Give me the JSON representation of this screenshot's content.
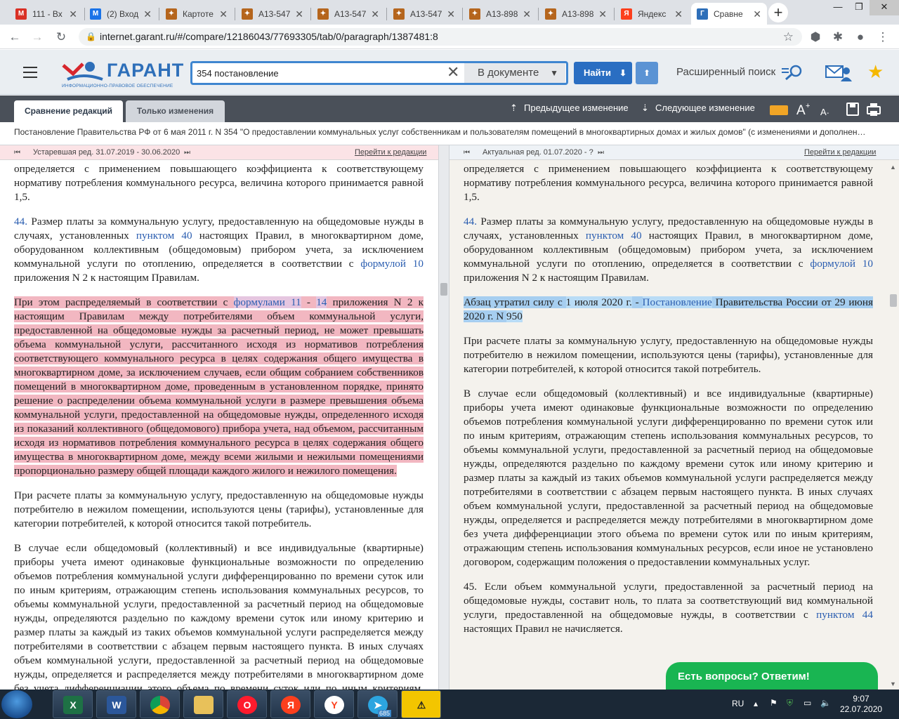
{
  "browser": {
    "tabs": [
      {
        "title": "111 - Вх",
        "icon": "gmail-icon",
        "color": "#d93025",
        "glyph": "M"
      },
      {
        "title": "(2) Вход",
        "icon": "mail-icon",
        "color": "#1a73e8",
        "glyph": "M"
      },
      {
        "title": "Картоте",
        "icon": "emblem-icon",
        "color": "#b5651d",
        "glyph": "✦"
      },
      {
        "title": "А13-547",
        "icon": "emblem-icon",
        "color": "#b5651d",
        "glyph": "✦"
      },
      {
        "title": "А13-547",
        "icon": "emblem-icon",
        "color": "#b5651d",
        "glyph": "✦"
      },
      {
        "title": "А13-547",
        "icon": "emblem-icon",
        "color": "#b5651d",
        "glyph": "✦"
      },
      {
        "title": "А13-898",
        "icon": "emblem-icon",
        "color": "#b5651d",
        "glyph": "✦"
      },
      {
        "title": "А13-898",
        "icon": "emblem-icon",
        "color": "#b5651d",
        "glyph": "✦"
      },
      {
        "title": "Яндекс",
        "icon": "yandex-icon",
        "color": "#fc3f1d",
        "glyph": "Я"
      },
      {
        "title": "Сравне",
        "icon": "garant-icon",
        "color": "#2e6fb9",
        "glyph": "Г",
        "active": true
      }
    ],
    "url": "internet.garant.ru/#/compare/12186043/77693305/tab/0/paragraph/1387481:8"
  },
  "garant": {
    "logo_word": "ГАРАНТ",
    "logo_sub": "ИНФОРМАЦИОННО-ПРАВОВОЕ ОБЕСПЕЧЕНИЕ",
    "search_value": "354 постановление",
    "scope": "В документе",
    "find": "Найти",
    "advanced": "Расширенный поиск"
  },
  "toolbar": {
    "tab_compare": "Сравнение редакций",
    "tab_changes": "Только изменения",
    "prev_change": "Предыдущее изменение",
    "next_change": "Следующее изменение"
  },
  "doc_title": "Постановление Правительства РФ от 6 мая 2011 г. N 354 \"О предоставлении коммунальных услуг собственникам и пользователям помещений в многоквартирных домах и жилых домов\" (с изменениями и дополнен…",
  "left_pane": {
    "label": "Устаревшая ред. 31.07.2019 - 30.06.2020",
    "goto": "Перейти к редакции"
  },
  "right_pane": {
    "label": "Актуальная ред. 01.07.2020 - ?",
    "goto": "Перейти к редакции"
  },
  "text": {
    "p0": "определяется с применением повышающего коэффициента к соответствующему нормативу потребления коммунального ресурса, величина которого принимается равной 1,5.",
    "p44_num": "44.",
    "p44_a": " Размер платы за коммунальную услугу, предоставленную на общедомовые нужды в случаях, установленных ",
    "p44_link1": "пунктом 40",
    "p44_b": " настоящих Правил, в многоквартирном доме, оборудованном коллективным (общедомовым) прибором учета, за исключением коммунальной услуги по отоплению, определяется в соответствии с ",
    "p44_link2": "формулой 10",
    "p44_c": " приложения N 2 к настоящим Правилам.",
    "old_a": "При этом распределяемый в соответствии с ",
    "old_link1": "формулами 11",
    "old_dash": " - ",
    "old_link2": "14",
    "old_b": " приложения N 2 к настоящим Правилам между потребителями объем коммунальной услуги, предоставленной на общедомовые нужды за расчетный период, не может превышать объема коммунальной услуги, рассчитанного исходя из нормативов потребления соответствующего коммунального ресурса в целях содержания общего имущества в многоквартирном доме, за исключением случаев, если общим собранием собственников помещений в многоквартирном доме, проведенным в установленном порядке, принято решение о распределении объема коммунальной услуги в размере превышения объема коммунальной услуги, предоставленной на общедомовые нужды, определенного исходя из показаний коллективного (общедомового) прибора учета, над объемом, рассчитанным исходя из нормативов потребления коммунального ресурса в целях содержания общего имущества в многоквартирном доме, между всеми жилыми и нежилыми помещениями пропорционально размеру общей площади каждого жилого и нежилого помещения.",
    "new_a": "Абзац утратил силу с ",
    "new_date": "1 июля 2020 г.",
    "new_dash": " - ",
    "new_link": "Постановление",
    "new_b": " Правительства России от 29 июня 2020 г. N ",
    "new_num": "950",
    "p_tariff": "При расчете платы за коммунальную услугу, предоставленную на общедомовые нужды потребителю в нежилом помещении, используются цены (тарифы), установленные для категории потребителей, к которой относится такой потребитель.",
    "p_case": "В случае если общедомовый (коллективный) и все индивидуальные (квартирные) приборы учета имеют одинаковые функциональные возможности по определению объемов потребления коммунальной услуги дифференцированно по времени суток или по иным критериям, отражающим степень использования коммунальных ресурсов, то объемы коммунальной услуги, предоставленной за расчетный период на общедомовые нужды, определяются раздельно по каждому времени суток или иному критерию и размер платы за каждый из таких объемов коммунальной услуги распределяется между потребителями в соответствии с абзацем первым настоящего пункта. В иных случаях объем коммунальной услуги, предоставленной за расчетный период на общедомовые нужды, определяется и распределяется между потребителями в многоквартирном доме без учета дифференциации этого объема по времени суток или по иным критериям, отражающим степень использования коммунальных ресурсов, если иное не установлено договором, содержащим положения о предоставлении коммунальных услуг.",
    "p45_a": "45. Если объем коммунальной услуги, предоставленной за расчетный период на общедомовые нужды, составит ноль, то плата за соответствующий вид коммунальной услуги, предоставленной на общедомовые нужды, в соответствии с ",
    "p45_link": "пунктом 44",
    "p45_b": " настоящих Правил не начисляется."
  },
  "chat": "Есть вопросы? Ответим!",
  "taskbar": {
    "lang": "RU",
    "time": "9:07",
    "date": "22.07.2020",
    "telegram_badge": "685"
  }
}
